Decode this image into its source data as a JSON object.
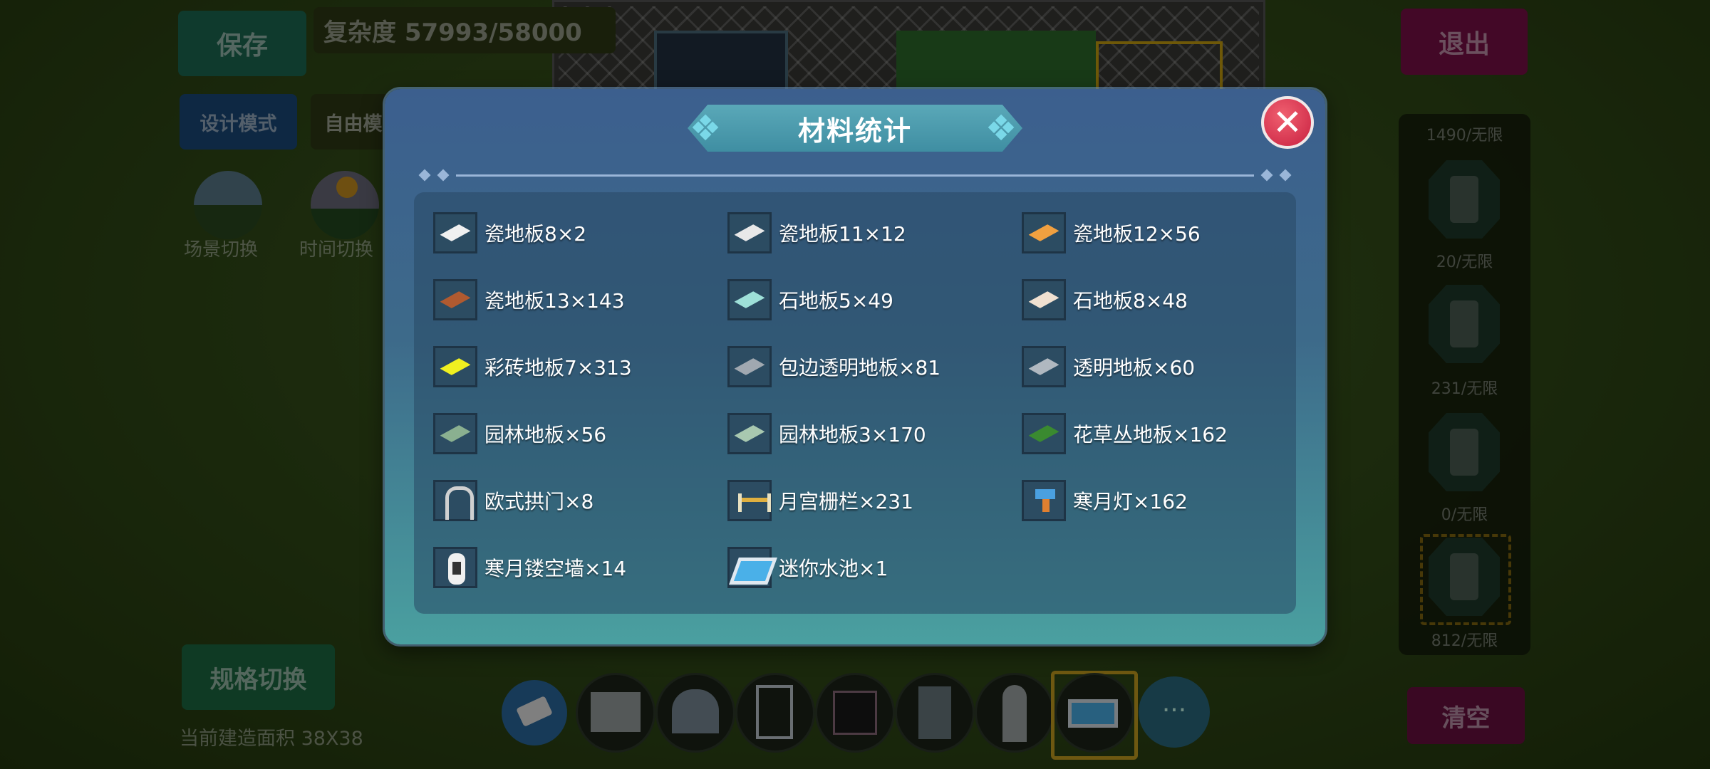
{
  "hud": {
    "save_label": "保存",
    "complexity_label": "复杂度 57993/58000",
    "design_mode_label": "设计模式",
    "free_mode_label": "自由模",
    "scene_switch_label": "场景切换",
    "time_switch_label": "时间切换",
    "spec_switch_label": "规格切换",
    "area_label": "当前建造面积 38X38",
    "exit_label": "退出",
    "clear_label": "清空"
  },
  "right_panel": {
    "counts": [
      "1490/无限",
      "20/无限",
      "231/无限",
      "0/无限",
      "812/无限"
    ]
  },
  "modal": {
    "title": "材料统计",
    "close_icon": "close-icon",
    "materials": [
      {
        "label": "瓷地板8×2",
        "icon": "white-tile-icon"
      },
      {
        "label": "瓷地板11×12",
        "icon": "white-tile-icon"
      },
      {
        "label": "瓷地板12×56",
        "icon": "orange-tile-icon"
      },
      {
        "label": "瓷地板13×143",
        "icon": "brick-tile-icon"
      },
      {
        "label": "石地板5×49",
        "icon": "teal-stone-icon"
      },
      {
        "label": "石地板8×48",
        "icon": "beige-stone-icon"
      },
      {
        "label": "彩砖地板7×313",
        "icon": "yellow-tile-icon"
      },
      {
        "label": "包边透明地板×81",
        "icon": "glass-floor-icon"
      },
      {
        "label": "透明地板×60",
        "icon": "glass-floor-icon"
      },
      {
        "label": "园林地板×56",
        "icon": "garden-floor-icon"
      },
      {
        "label": "园林地板3×170",
        "icon": "garden-floor-icon"
      },
      {
        "label": "花草丛地板×162",
        "icon": "flower-grass-icon"
      },
      {
        "label": "欧式拱门×8",
        "icon": "arch-door-icon"
      },
      {
        "label": "月宫栅栏×231",
        "icon": "fence-icon"
      },
      {
        "label": "寒月灯×162",
        "icon": "lamp-icon"
      },
      {
        "label": "寒月镂空墙×14",
        "icon": "hollow-wall-icon"
      },
      {
        "label": "迷你水池×1",
        "icon": "pool-icon"
      }
    ]
  },
  "toolbar": {
    "more_label": "···"
  },
  "colors": {
    "modal_top": "#3c5f8e",
    "modal_bottom": "#4aa0a0",
    "close_red": "#c82040",
    "save_green": "#1d6a52",
    "exit_magenta": "#7a1048"
  }
}
